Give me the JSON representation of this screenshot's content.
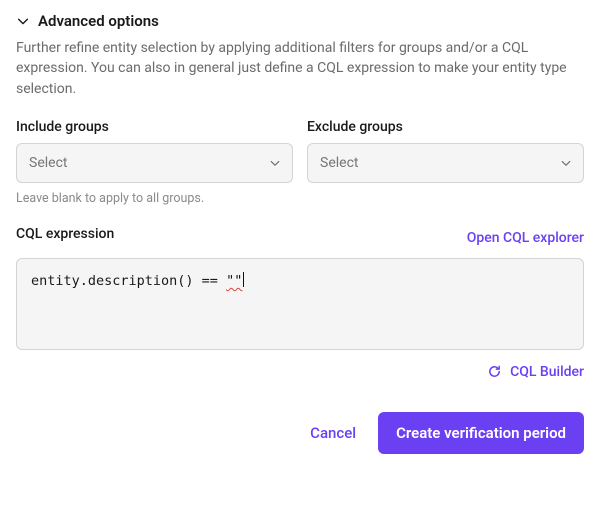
{
  "section": {
    "title": "Advanced options",
    "description": "Further refine entity selection by applying additional filters for groups and/or a CQL expression. You can also in general just define a CQL expression to make your entity type selection."
  },
  "groups": {
    "include_label": "Include groups",
    "exclude_label": "Exclude groups",
    "placeholder": "Select",
    "hint": "Leave blank to apply to all groups."
  },
  "cql": {
    "label": "CQL expression",
    "open_explorer": "Open CQL explorer",
    "expression_prefix": "entity.description() == ",
    "expression_quoted": "\"\"",
    "builder": "CQL Builder"
  },
  "actions": {
    "cancel": "Cancel",
    "submit": "Create verification period"
  },
  "colors": {
    "accent": "#6b3ff2"
  }
}
